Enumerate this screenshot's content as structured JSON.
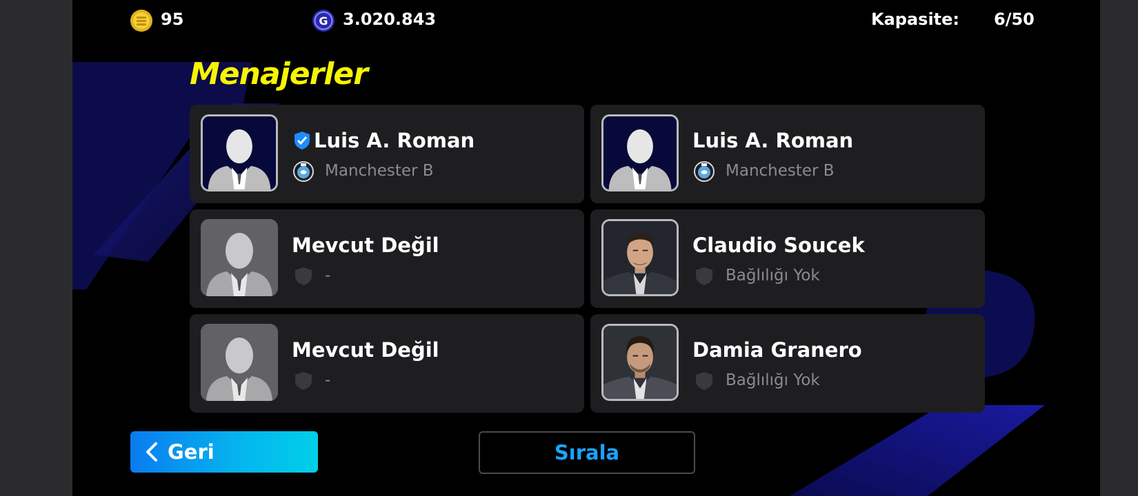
{
  "header": {
    "coins_icon": "efootball-coin-icon",
    "coins": "95",
    "gp_icon": "gp-icon",
    "gp": "3.020.843",
    "capacity_label": "Kapasite:",
    "capacity_value": "6/50"
  },
  "page_title": "Menajerler",
  "managers": [
    {
      "name": "Luis A. Roman",
      "club": "Manchester B",
      "verified": true,
      "portrait": "silhouette-icon",
      "club_icon": "manchester-b-crest-icon"
    },
    {
      "name": "Luis A. Roman",
      "club": "Manchester B",
      "verified": false,
      "portrait": "silhouette-icon",
      "club_icon": "manchester-b-crest-icon"
    },
    {
      "name": "Mevcut Değil",
      "club": "-",
      "verified": false,
      "portrait": "silhouette-icon",
      "club_icon": "shield-icon"
    },
    {
      "name": "Claudio Soucek",
      "club": "Bağlılığı Yok",
      "verified": false,
      "portrait": "manager-photo",
      "club_icon": "shield-icon"
    },
    {
      "name": "Mevcut Değil",
      "club": "-",
      "verified": false,
      "portrait": "silhouette-icon",
      "club_icon": "shield-icon"
    },
    {
      "name": "Damia Granero",
      "club": "Bağlılığı Yok",
      "verified": false,
      "portrait": "manager-photo",
      "club_icon": "shield-icon"
    }
  ],
  "buttons": {
    "back": "Geri",
    "sort": "Sırala"
  },
  "colors": {
    "title": "#f7f500",
    "card": "#1e1e21",
    "accent_blue": "#1aa3ff",
    "back_gradient_start": "#0a7cf0",
    "back_gradient_end": "#00cfe8"
  }
}
